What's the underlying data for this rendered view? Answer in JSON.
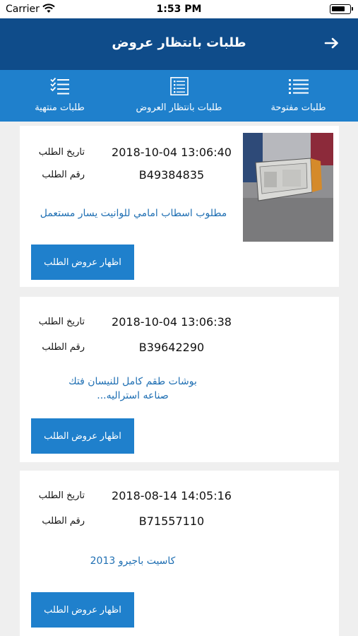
{
  "status_bar": {
    "carrier": "Carrier",
    "time": "1:53 PM"
  },
  "header": {
    "title": "طلبات بانتظار عروض"
  },
  "tabs": [
    {
      "label": "طلبات مفتوحة",
      "icon": "list-icon"
    },
    {
      "label": "طلبات بانتظار العروض",
      "icon": "document-list-icon"
    },
    {
      "label": "طلبات منتهية",
      "icon": "checklist-icon"
    }
  ],
  "labels": {
    "date": "تاريخ الطلب",
    "number": "رقم الطلب",
    "button": "اظهار عروض الطلب"
  },
  "requests": [
    {
      "date": "2018-10-04 13:06:40",
      "number": "B49384835",
      "description": "مطلوب اسطاب امامي للوانيت يسار مستعمل",
      "has_image": true
    },
    {
      "date": "2018-10-04 13:06:38",
      "number": "B39642290",
      "description": "بوشات طقم كامل للنيسان فتك صناعه استراليه...",
      "has_image": false
    },
    {
      "date": "2018-08-14 14:05:16",
      "number": "B71557110",
      "description": "كاسيت باجيرو 2013",
      "has_image": false
    }
  ],
  "colors": {
    "header": "#0f4c8a",
    "tab_bar": "#1f80cc",
    "button": "#1f80cc",
    "link_text": "#1f6fb3",
    "background": "#efefef"
  }
}
